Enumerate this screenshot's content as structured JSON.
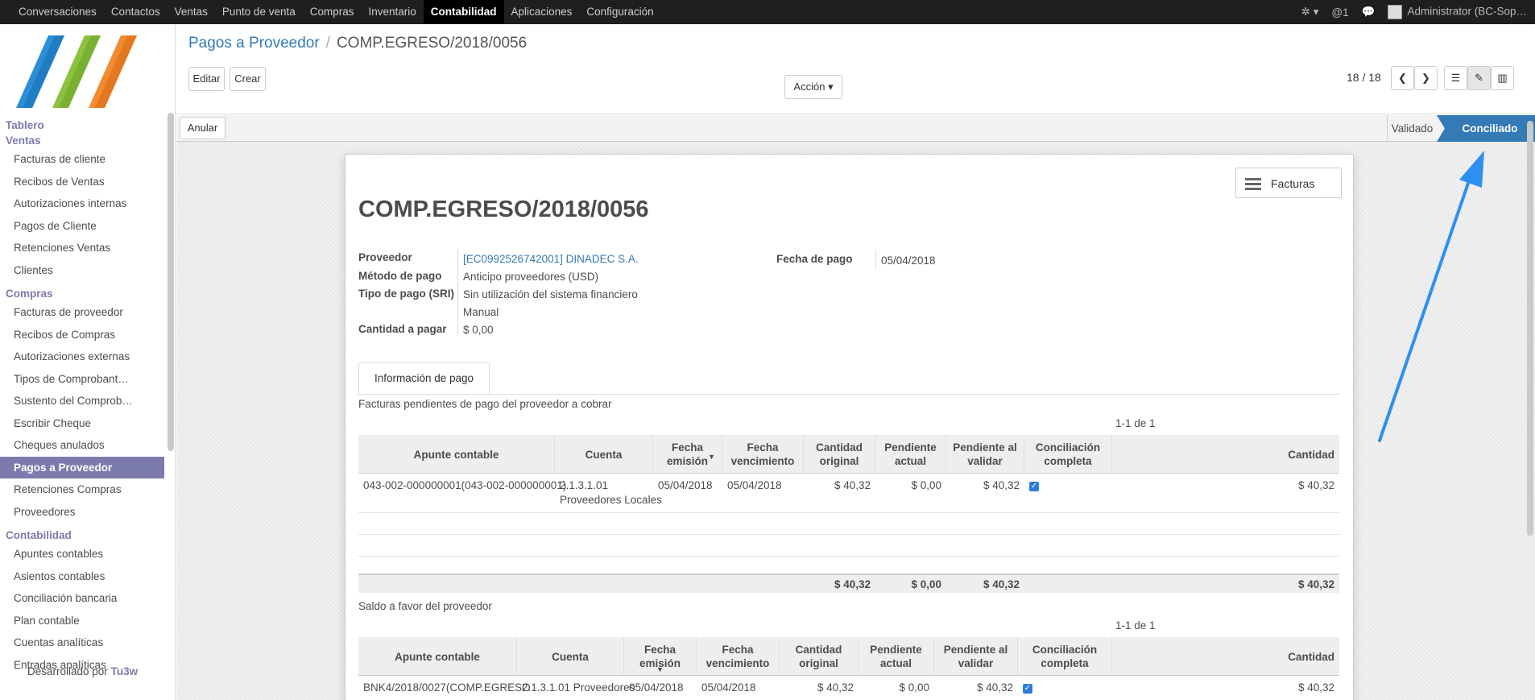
{
  "topbar": {
    "menu": [
      "Conversaciones",
      "Contactos",
      "Ventas",
      "Punto de venta",
      "Compras",
      "Inventario",
      "Contabilidad",
      "Aplicaciones",
      "Configuración"
    ],
    "active_index": 6,
    "bug_icon": "bug-icon",
    "activity": "@1",
    "user": "Administrator (BC-Sop…"
  },
  "sidebar": {
    "cat_tablero": "Tablero",
    "cat_ventas": "Ventas",
    "ventas_items": [
      "Facturas de cliente",
      "Recibos de Ventas",
      "Autorizaciones internas",
      "Pagos de Cliente",
      "Retenciones Ventas",
      "Clientes"
    ],
    "cat_compras": "Compras",
    "compras_items": [
      "Facturas de proveedor",
      "Recibos de Compras",
      "Autorizaciones externas",
      "Tipos de Comprobant…",
      "Sustento del Comprob…",
      "Escribir Cheque",
      "Cheques anulados",
      "Pagos a Proveedor",
      "Retenciones Compras",
      "Proveedores"
    ],
    "cat_contabilidad": "Contabilidad",
    "contabilidad_items": [
      "Apuntes contables",
      "Asientos contables",
      "Conciliación bancaria",
      "Plan contable",
      "Cuentas analíticas",
      "Entradas analíticas"
    ],
    "developed_by": "Desarrollado por",
    "developer": "Tu3w"
  },
  "control": {
    "breadcrumb_parent": "Pagos a Proveedor",
    "breadcrumb_current": "COMP.EGRESO/2018/0056",
    "edit": "Editar",
    "create": "Crear",
    "action": "Acción",
    "pager": "18 / 18"
  },
  "statusbar": {
    "cancel": "Anular",
    "states": [
      "Validado",
      "Conciliado"
    ],
    "active_state": "Conciliado",
    "active_color": "#337ab7"
  },
  "form": {
    "smart_button": "Facturas",
    "title": "COMP.EGRESO/2018/0056",
    "labels": {
      "proveedor": "Proveedor",
      "metodo": "Método de pago",
      "tipo": "Tipo de pago (SRI)",
      "cantidad": "Cantidad a pagar",
      "fecha": "Fecha de pago"
    },
    "values": {
      "proveedor": "[EC0992526742001] DINADEC S.A.",
      "metodo": "Anticipo proveedores (USD)",
      "tipo": "Sin utilización del sistema financiero",
      "manual": "Manual",
      "cantidad": "$ 0,00",
      "fecha": "05/04/2018"
    },
    "tab": "Información de pago",
    "section1": "Facturas pendientes de pago del proveedor a cobrar",
    "pager1": "1-1 de 1",
    "section2": "Saldo a favor del proveedor",
    "pager2": "1-1 de 1"
  },
  "table1": {
    "headers": [
      "Apunte contable",
      "Cuenta",
      "Fecha emisión",
      "Fecha vencimiento",
      "Cantidad original",
      "Pendiente actual",
      "Pendiente al validar",
      "Conciliación completa",
      "Cantidad"
    ],
    "row": {
      "apunte": "043-002-000000001(043-002-000000001)",
      "cuenta1": "2.1.3.1.01",
      "cuenta2": "Proveedores Locales",
      "emision": "05/04/2018",
      "vencimiento": "05/04/2018",
      "original": "$ 40,32",
      "pendiente": "$ 0,00",
      "al_validar": "$ 40,32",
      "cantidad": "$ 40,32"
    },
    "totals": {
      "original": "$ 40,32",
      "pendiente": "$ 0,00",
      "al_validar": "$ 40,32",
      "cantidad": "$ 40,32"
    }
  },
  "table2": {
    "headers": [
      "Apunte contable",
      "Cuenta",
      "Fecha emisión",
      "Fecha vencimiento",
      "Cantidad original",
      "Pendiente actual",
      "Pendiente al validar",
      "Conciliación completa",
      "Cantidad"
    ],
    "row": {
      "apunte": "BNK4/2018/0027(COMP.EGRESO",
      "cuenta": "2.1.3.1.01 Proveedores",
      "emision": "05/04/2018",
      "vencimiento": "05/04/2018",
      "original": "$ 40,32",
      "pendiente": "$ 0,00",
      "al_validar": "$ 40,32",
      "cantidad": "$ 40,32"
    }
  },
  "annotation": {
    "arrow_color": "#2e8ff0"
  }
}
